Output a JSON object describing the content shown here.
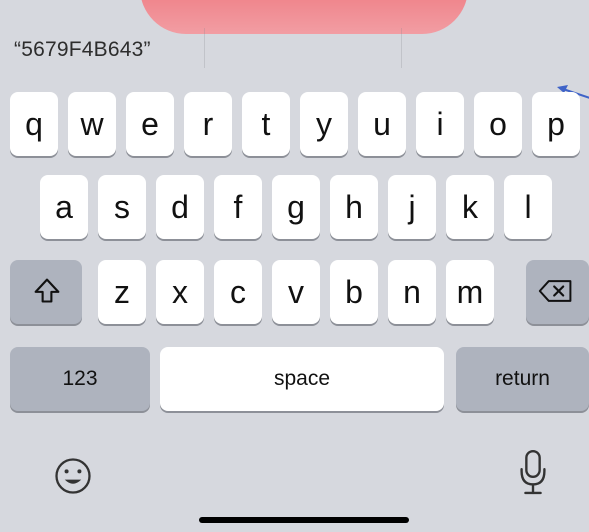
{
  "suggestions": {
    "left": "“5679F4B643”",
    "center": "",
    "right": ""
  },
  "keyboard": {
    "row1": [
      "q",
      "w",
      "e",
      "r",
      "t",
      "y",
      "u",
      "i",
      "o",
      "p"
    ],
    "row2": [
      "a",
      "s",
      "d",
      "f",
      "g",
      "h",
      "j",
      "k",
      "l"
    ],
    "row3": [
      "z",
      "x",
      "c",
      "v",
      "b",
      "n",
      "m"
    ],
    "numbers_label": "123",
    "space_label": "space",
    "return_label": "return"
  },
  "icons": {
    "shift": "shift-icon",
    "delete": "delete-icon",
    "emoji": "emoji-icon",
    "dictation": "microphone-icon",
    "pointer": "arrow-icon"
  },
  "colors": {
    "background": "#d6d8de",
    "key": "#ffffff",
    "function_key": "#aeb3be",
    "top_pill": "#ef5a62",
    "arrow": "#3f63c8"
  }
}
